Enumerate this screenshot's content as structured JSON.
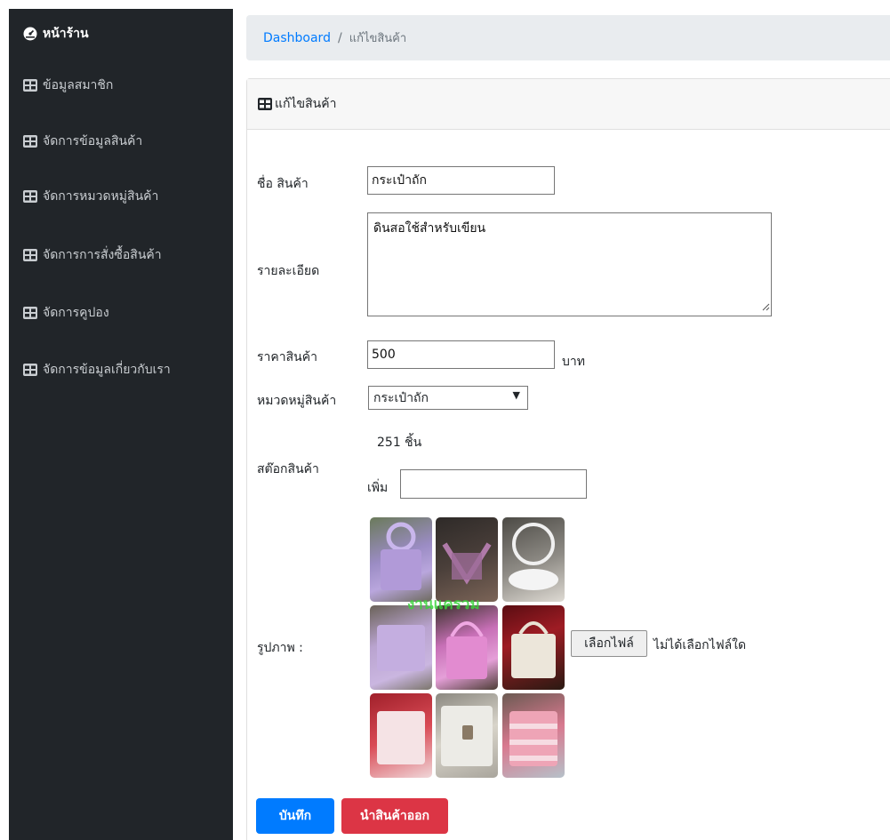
{
  "sidebar": {
    "items": [
      {
        "label": "หน้าร้าน",
        "icon": "dashboard-icon"
      },
      {
        "label": "ข้อมูลสมาชิก",
        "icon": "table-icon"
      },
      {
        "label": "จัดการข้อมูลสินค้า",
        "icon": "table-icon"
      },
      {
        "label": "จัดการหมวดหมู่สินค้า",
        "icon": "table-icon"
      },
      {
        "label": "จัดการการสั่งซื้อสินค้า",
        "icon": "table-icon"
      },
      {
        "label": "จัดการคูปอง",
        "icon": "table-icon"
      },
      {
        "label": "จัดการข้อมูลเกี่ยวกับเรา",
        "icon": "table-icon"
      }
    ]
  },
  "breadcrumb": {
    "home": "Dashboard",
    "separator": "/",
    "current": "แก้ไขสินค้า"
  },
  "card": {
    "title": "แก้ไขสินค้า",
    "icon": "table-icon"
  },
  "form": {
    "name_label": "ชื่อ สินค้า",
    "name_value": "กระเป๋าถัก",
    "detail_label": "รายละเอียด",
    "detail_value": "ดินสอใช้สำหรับเขียน",
    "price_label": "ราคาสินค้า",
    "price_value": "500",
    "price_unit": "บาท",
    "category_label": "หมวดหมู่สินค้า",
    "category_value": "กระเป๋าถัก",
    "stock_label": "สต๊อกสินค้า",
    "stock_value": "251 ชิ้น",
    "add_label": "เพิ่ม",
    "add_value": "",
    "image_label": "รูปภาพ :",
    "image_watermark": "งานแครวม",
    "file_button": "เลือกไฟล์",
    "file_status": "ไม่ได้เลือกไฟล์ใด"
  },
  "actions": {
    "save": "บันทึก",
    "remove": "นำสินค้าออก"
  },
  "colors": {
    "sidebar": "#212529",
    "primary": "#007bff",
    "danger": "#dc3545",
    "breadcrumb_bg": "#e9ecef",
    "watermark": "#39d43a"
  }
}
